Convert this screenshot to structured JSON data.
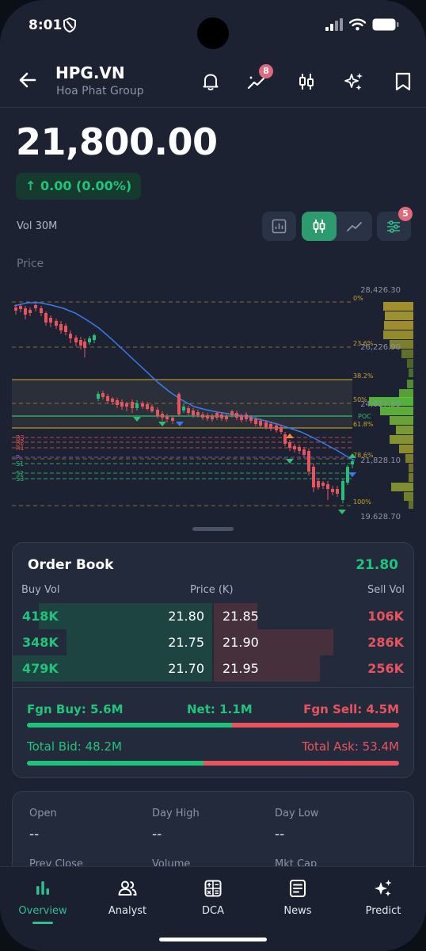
{
  "status_bar": {
    "time": "8:01"
  },
  "header": {
    "ticker": "HPG.VN",
    "company": "Hoa Phat Group",
    "signals_badge": "8",
    "icons": [
      "back-arrow-icon",
      "bell-icon",
      "trend-signals-icon",
      "candles-icon",
      "sparkles-icon",
      "bookmark-icon"
    ]
  },
  "quote": {
    "price": "21,800.00",
    "change": "↑ 0.00  (0.00%)",
    "volume": "Vol 30M"
  },
  "chart_controls": {
    "indicators_badge": "5"
  },
  "chart_label": "Price",
  "chart_data": {
    "type": "candlestick",
    "price_axis": [
      "28,426.30",
      "26,226.90",
      "24,027.50",
      "21,828.10",
      "19,628.70"
    ],
    "fib_levels": [
      "0%",
      "23.6%",
      "38.2%",
      "50%",
      "61.8%",
      "78.6%",
      "100%"
    ],
    "pivot_labels": [
      "R3",
      "R2",
      "R1",
      "P",
      "S1",
      "S2",
      "S3"
    ],
    "poc_label": "POC",
    "colors": {
      "up": "#22c17a",
      "down": "#e8545d",
      "ma": "#3b7bf0",
      "fib": "#c9a227",
      "pivot_r": "#e05a4d",
      "pivot_s": "#2fbf72",
      "pivot_p": "#a05ad8"
    }
  },
  "order_book": {
    "title": "Order Book",
    "last": "21.80",
    "headers": {
      "buy_vol": "Buy Vol",
      "price": "Price (K)",
      "sell_vol": "Sell Vol"
    },
    "rows": [
      {
        "bid_vol": "418K",
        "bid_price": "21.80",
        "ask_price": "21.85",
        "ask_vol": "106K",
        "bid_fill": 0.87,
        "ask_fill": 0.22
      },
      {
        "bid_vol": "348K",
        "bid_price": "21.75",
        "ask_price": "21.90",
        "ask_vol": "286K",
        "bid_fill": 0.73,
        "ask_fill": 0.6
      },
      {
        "bid_vol": "479K",
        "bid_price": "21.70",
        "ask_price": "21.95",
        "ask_vol": "256K",
        "bid_fill": 1.0,
        "ask_fill": 0.53
      }
    ],
    "foreign": {
      "buy": "Fgn Buy: 5.6M",
      "net": "Net: 1.1M",
      "sell": "Fgn Sell: 4.5M",
      "buy_ratio": 0.55
    },
    "totals": {
      "bid": "Total Bid: 48.2M",
      "ask": "Total Ask: 53.4M",
      "bid_ratio": 0.474
    }
  },
  "details": {
    "open_label": "Open",
    "open_value": "--",
    "high_label": "Day High",
    "high_value": "--",
    "low_label": "Day Low",
    "low_value": "--",
    "prev_close_label": "Prev Close",
    "volume_label": "Volume",
    "mktcap_label": "Mkt Cap"
  },
  "tabs": [
    {
      "label": "Overview",
      "icon": "bar-chart-icon",
      "active": true
    },
    {
      "label": "Analyst",
      "icon": "people-icon",
      "active": false
    },
    {
      "label": "DCA",
      "icon": "calculator-icon",
      "active": false
    },
    {
      "label": "News",
      "icon": "newspaper-icon",
      "active": false
    },
    {
      "label": "Predict",
      "icon": "sparkles-icon",
      "active": false
    }
  ]
}
